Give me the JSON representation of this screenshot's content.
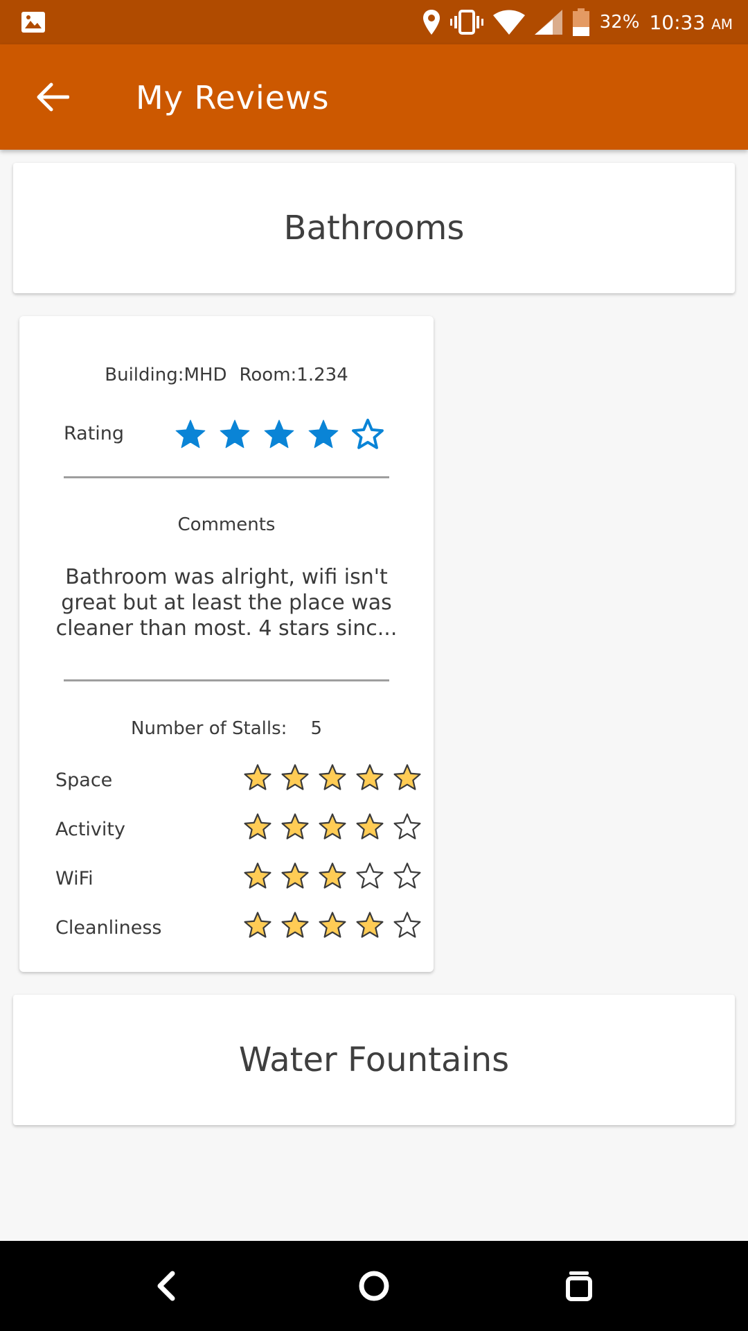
{
  "status_bar": {
    "battery_percent": "32%",
    "time": "10:33",
    "ampm": "AM",
    "icons": [
      "image-icon",
      "location-pin-icon",
      "vibrate-icon",
      "wifi-icon",
      "signal-icon",
      "battery-icon"
    ]
  },
  "app_bar": {
    "title": "My Reviews",
    "back_icon": "arrow-left-icon"
  },
  "sections": [
    {
      "title": "Bathrooms"
    },
    {
      "title": "Water Fountains"
    }
  ],
  "review": {
    "building": "Building:MHD",
    "room": "Room:1.234",
    "rating_label": "Rating",
    "rating": 4,
    "rating_max": 5,
    "comments_label": "Comments",
    "comments_text": "Bathroom was alright, wifi isn't great but at least the place was cleaner than most. 4 stars sinc...",
    "stalls_label": "Number of Stalls:",
    "stalls_value": "5",
    "attributes": [
      {
        "label": "Space",
        "value": 5
      },
      {
        "label": "Activity",
        "value": 4
      },
      {
        "label": "WiFi",
        "value": 3
      },
      {
        "label": "Cleanliness",
        "value": 4
      }
    ]
  },
  "colors": {
    "status_bar": "#b04b00",
    "app_bar": "#cc5800",
    "rating_star": "#0a84d6",
    "attr_star_fill": "#ffcc55",
    "attr_star_outline": "#3a3a3a"
  },
  "nav_bar": {
    "icons": [
      "back-nav-icon",
      "home-nav-icon",
      "recents-nav-icon"
    ]
  }
}
